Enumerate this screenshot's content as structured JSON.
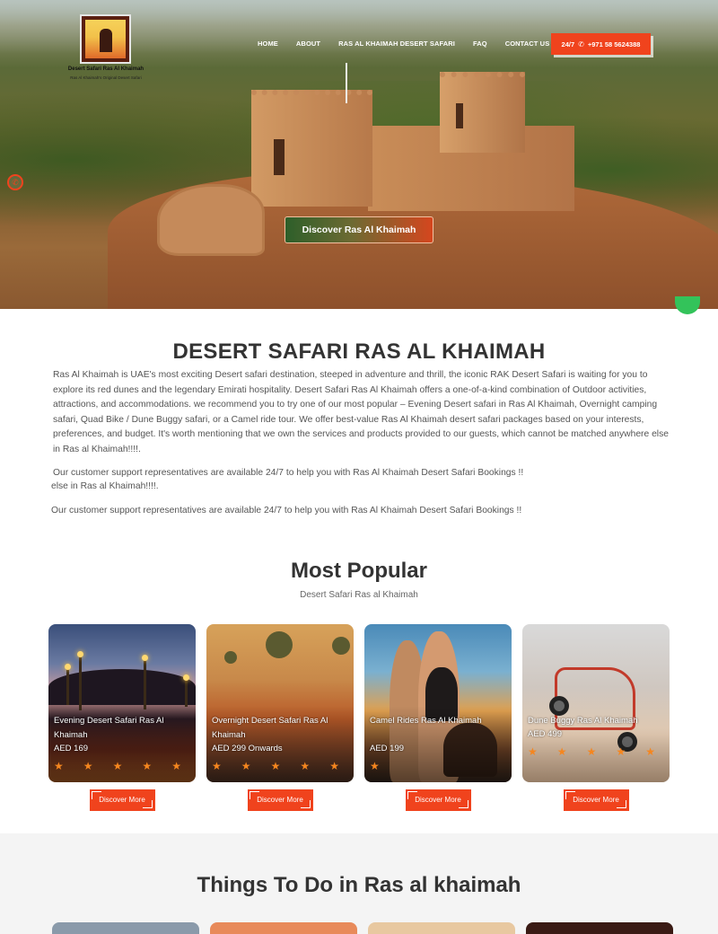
{
  "logo": {
    "name": "Desert Safari Ras Al Khaimah",
    "tagline": "Ras Al Khaimah's Original Desert Safari"
  },
  "nav": {
    "items": [
      "HOME",
      "ABOUT",
      "RAS AL KHAIMAH DESERT SAFARI",
      "FAQ",
      "CONTACT US"
    ],
    "phone_label": "24/7",
    "phone_number": "+971 58 5624388"
  },
  "hero": {
    "button_label": "Discover Ras Al Khaimah"
  },
  "intro": {
    "title": "DESERT SAFARI RAS AL KHAIMAH",
    "paragraph": "Ras Al Khaimah is UAE's most exciting Desert safari destination, steeped in adventure and thrill, the iconic RAK Desert Safari is waiting for you to explore its red dunes and the legendary Emirati hospitality. Desert Safari Ras Al Khaimah offers a one-of-a-kind combination of Outdoor activities, attractions, and accommodations. we recommend you to try one of our most popular – Evening Desert safari in Ras Al Khaimah, Overnight camping safari, Quad Bike / Dune Buggy safari, or a Camel ride tour. We offer best-value Ras Al Khaimah desert safari packages based on your interests, preferences, and budget. It's worth mentioning that we own the services and products provided to our guests, which cannot be matched anywhere else in Ras al Khaimah!!!!.",
    "support_line_1": "Our customer support representatives are available 24/7 to help you with Ras Al Khaimah Desert Safari Bookings !!",
    "support_line_1b": "else in Ras al Khaimah!!!!.",
    "support_line_2": "Our customer support representatives are available 24/7 to help you with Ras Al Khaimah Desert Safari Bookings !!"
  },
  "popular": {
    "title": "Most Popular",
    "subtitle": "Desert Safari Ras al Khaimah",
    "cards": [
      {
        "title": "Evening Desert Safari Ras Al Khaimah",
        "price": "AED 169",
        "button": "Discover More",
        "stars": 5
      },
      {
        "title": "Overnight Desert Safari Ras Al Khaimah",
        "price": "AED 299 Onwards",
        "button": "Discover More",
        "stars": 5
      },
      {
        "title": "Camel Rides Ras Al Khaimah",
        "price": "AED 199",
        "button": "Discover More",
        "stars": 1
      },
      {
        "title": "Dune Buggy Ras Al Khaimah",
        "price": "AED 499",
        "button": "Discover More",
        "stars": 5
      }
    ]
  },
  "things": {
    "title": "Things To Do in Ras al khaimah"
  },
  "colors": {
    "accent": "#f0431d",
    "star": "#f5861f",
    "whatsapp": "#33c35a"
  },
  "icons": {
    "phone": "phone-icon",
    "chat": "chat-icon",
    "star": "star-icon",
    "whatsapp": "whatsapp-icon"
  }
}
